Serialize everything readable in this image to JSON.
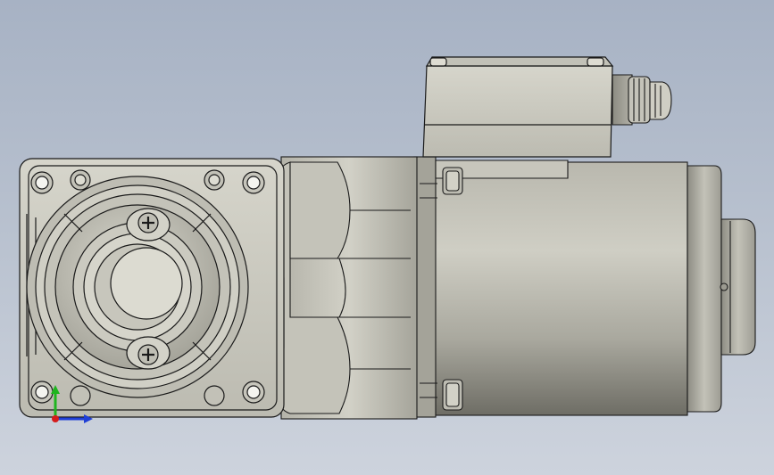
{
  "viewport": {
    "background_top": "#a7b2c4",
    "background_bottom": "#cdd3dd",
    "model_body_color": "#c9c8be",
    "model_dark_color": "#8f8e84",
    "model_edge_color": "#1a1a1a"
  },
  "model": {
    "parts": [
      "gearbox-housing",
      "output-flange",
      "gear-adapter",
      "motor-body",
      "rear-end-cap",
      "terminal-box",
      "cable-gland"
    ]
  },
  "triad": {
    "x_color": "#1f3fd6",
    "y_color": "#1fb51f",
    "z_color": "#d41c1c"
  }
}
